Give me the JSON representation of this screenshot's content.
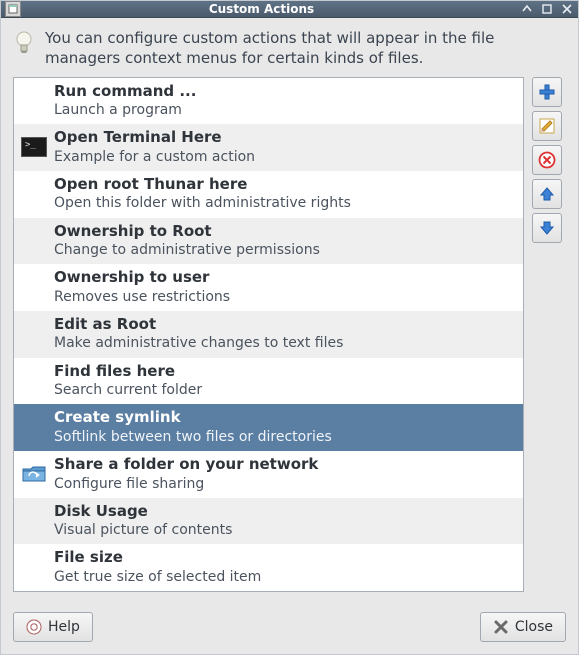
{
  "window": {
    "title": "Custom Actions"
  },
  "intro": "You can configure custom actions that will appear in the file managers context menus for certain kinds of files.",
  "actions": [
    {
      "title": "Run command ...",
      "desc": "Launch a program",
      "icon": "none",
      "selected": false
    },
    {
      "title": "Open Terminal Here",
      "desc": "Example for a custom action",
      "icon": "terminal",
      "selected": false
    },
    {
      "title": "Open root Thunar here",
      "desc": "Open this folder with administrative rights",
      "icon": "none",
      "selected": false
    },
    {
      "title": "Ownership to Root",
      "desc": "Change to administrative permissions",
      "icon": "none",
      "selected": false
    },
    {
      "title": "Ownership to user",
      "desc": "Removes use restrictions",
      "icon": "none",
      "selected": false
    },
    {
      "title": "Edit as Root",
      "desc": "Make administrative changes to text files",
      "icon": "none",
      "selected": false
    },
    {
      "title": "Find files here",
      "desc": "Search current folder",
      "icon": "none",
      "selected": false
    },
    {
      "title": "Create symlink",
      "desc": "Softlink between two files or directories",
      "icon": "none",
      "selected": true
    },
    {
      "title": "Share a folder on your network",
      "desc": "Configure file sharing",
      "icon": "folder-share",
      "selected": false
    },
    {
      "title": "Disk Usage",
      "desc": "Visual picture of contents",
      "icon": "none",
      "selected": false
    },
    {
      "title": "File size",
      "desc": "Get true size of selected item",
      "icon": "none",
      "selected": false
    }
  ],
  "buttons": {
    "help": "Help",
    "close": "Close"
  },
  "side": {
    "add": "add",
    "edit": "edit",
    "delete": "delete",
    "up": "up",
    "down": "down"
  }
}
